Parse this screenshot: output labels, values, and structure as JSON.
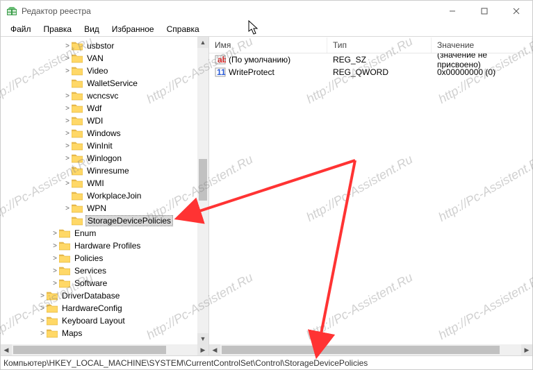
{
  "window": {
    "title": "Редактор реестра"
  },
  "menu": {
    "file": "Файл",
    "edit": "Правка",
    "view": "Вид",
    "favorites": "Избранное",
    "help": "Справка"
  },
  "tree": {
    "items": [
      {
        "indent": 5,
        "exp": ">",
        "label": "usbstor"
      },
      {
        "indent": 5,
        "exp": ">",
        "label": "VAN"
      },
      {
        "indent": 5,
        "exp": ">",
        "label": "Video"
      },
      {
        "indent": 5,
        "exp": "",
        "label": "WalletService"
      },
      {
        "indent": 5,
        "exp": ">",
        "label": "wcncsvc"
      },
      {
        "indent": 5,
        "exp": ">",
        "label": "Wdf"
      },
      {
        "indent": 5,
        "exp": ">",
        "label": "WDI"
      },
      {
        "indent": 5,
        "exp": ">",
        "label": "Windows"
      },
      {
        "indent": 5,
        "exp": ">",
        "label": "WinInit"
      },
      {
        "indent": 5,
        "exp": ">",
        "label": "Winlogon"
      },
      {
        "indent": 5,
        "exp": "",
        "label": "Winresume"
      },
      {
        "indent": 5,
        "exp": ">",
        "label": "WMI"
      },
      {
        "indent": 5,
        "exp": "",
        "label": "WorkplaceJoin"
      },
      {
        "indent": 5,
        "exp": ">",
        "label": "WPN"
      },
      {
        "indent": 5,
        "exp": "",
        "label": "StorageDevicePolicies",
        "selected": true
      },
      {
        "indent": 4,
        "exp": ">",
        "label": "Enum"
      },
      {
        "indent": 4,
        "exp": ">",
        "label": "Hardware Profiles"
      },
      {
        "indent": 4,
        "exp": ">",
        "label": "Policies"
      },
      {
        "indent": 4,
        "exp": ">",
        "label": "Services"
      },
      {
        "indent": 4,
        "exp": ">",
        "label": "Software"
      },
      {
        "indent": 3,
        "exp": ">",
        "label": "DriverDatabase"
      },
      {
        "indent": 3,
        "exp": ">",
        "label": "HardwareConfig"
      },
      {
        "indent": 3,
        "exp": ">",
        "label": "Keyboard Layout"
      },
      {
        "indent": 3,
        "exp": ">",
        "label": "Maps"
      }
    ]
  },
  "list": {
    "headers": {
      "name": "Имя",
      "type": "Тип",
      "value": "Значение"
    },
    "rows": [
      {
        "icon": "string",
        "name": "(По умолчанию)",
        "type": "REG_SZ",
        "value": "(значение не присвоено)"
      },
      {
        "icon": "binary",
        "name": "WriteProtect",
        "type": "REG_QWORD",
        "value": "0x00000000 (0)"
      }
    ]
  },
  "statusbar": {
    "path": "Компьютер\\HKEY_LOCAL_MACHINE\\SYSTEM\\CurrentControlSet\\Control\\StorageDevicePolicies"
  },
  "watermark": "http://Pc-Assistent.Ru"
}
